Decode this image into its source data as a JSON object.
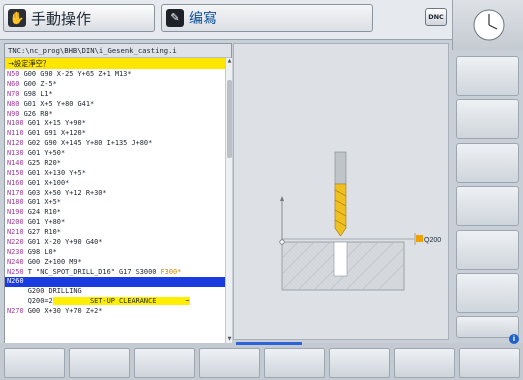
{
  "header": {
    "mode_left": {
      "label": "手動操作",
      "icon": "hand-icon"
    },
    "mode_right": {
      "label": "编寫",
      "icon": "edit-icon"
    },
    "dnc_label": "DNC"
  },
  "program": {
    "path": "TNC:\\nc_prog\\BHB\\DIN\\i_Gesenk_casting.i",
    "status": "→設定淨空？",
    "lines": [
      {
        "n": "N50",
        "text": " G00 G90 X-25 Y+65 Z+1 M13*"
      },
      {
        "n": "N60",
        "text": " G00 Z-5*"
      },
      {
        "n": "N70",
        "text": " G98 L1*"
      },
      {
        "n": "N80",
        "text": " G01 X+5 Y+80 G41*"
      },
      {
        "n": "N90",
        "text": " G26 R8*"
      },
      {
        "n": "N100",
        "text": " G01 X+15 Y+90*"
      },
      {
        "n": "N110",
        "text": " G01 G91 X+120*"
      },
      {
        "n": "N120",
        "text": " G02 G90 X+145 Y+80 I+135 J+80*"
      },
      {
        "n": "N130",
        "text": " G01 Y+50*"
      },
      {
        "n": "N140",
        "text": " G25 R20*"
      },
      {
        "n": "N150",
        "text": " G01 X+130 Y+5*"
      },
      {
        "n": "N160",
        "text": " G01 X+100*"
      },
      {
        "n": "N170",
        "text": " G03 X+50 Y+12 R+30*"
      },
      {
        "n": "N180",
        "text": " G01 X+5*"
      },
      {
        "n": "N190",
        "text": " G24 R10*"
      },
      {
        "n": "N200",
        "text": " G01 Y+80*"
      },
      {
        "n": "N210",
        "text": " G27 R10*"
      },
      {
        "n": "N220",
        "text": " G01 X-20 Y+90 G40*"
      },
      {
        "n": "N230",
        "text": " G98 L0*"
      },
      {
        "n": "N240",
        "text": " G00 Z+100 M9*"
      },
      {
        "n": "N250",
        "text": " T \"NC_SPOT_DRILL_D16\" G17 S3000 ",
        "tail": "F300*"
      },
      {
        "n": "N260",
        "text": ""
      },
      {
        "n": "",
        "text": "     G200 DRILLING"
      },
      {
        "n": "",
        "text": "     Q200=2",
        "hl": " ",
        "text2": "        SET-UP CLEARANCE       ~"
      },
      {
        "n": "N270",
        "text": " G00 X+30 Y+70 Z+2*"
      }
    ]
  },
  "graphic": {
    "label": "Q200",
    "tool_colors": {
      "shank": "#bfc4c9",
      "flutes": "#f0c020",
      "workpiece": "#d4d8dc",
      "marker": "#f0a000"
    }
  },
  "softkeys": {
    "right_count": 7,
    "bottom_count": 8
  }
}
